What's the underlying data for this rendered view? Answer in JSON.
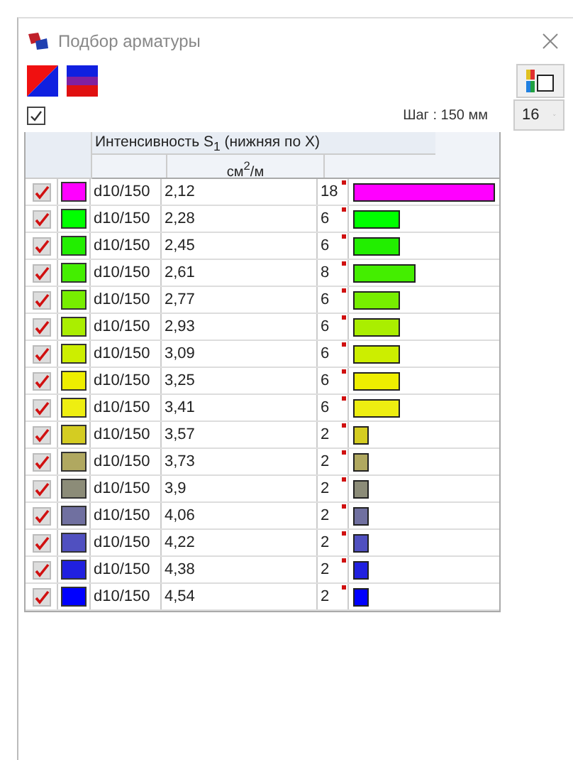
{
  "window": {
    "title": "Подбор арматуры"
  },
  "show_all": {
    "checked": true
  },
  "step": "Шаг : 150 мм",
  "count_select": {
    "value": "16"
  },
  "table": {
    "title": "Интенсивность S$_{1}$ (нижняя по X)",
    "unit": "см$^{2}$/м",
    "rows": [
      {
        "checked": true,
        "color": "#ff00ff",
        "name": "d10/150",
        "value": "2,12",
        "count": "18"
      },
      {
        "checked": true,
        "color": "#00ff00",
        "name": "d10/150",
        "value": "2,28",
        "count": "6"
      },
      {
        "checked": true,
        "color": "#22ee00",
        "name": "d10/150",
        "value": "2,45",
        "count": "6"
      },
      {
        "checked": true,
        "color": "#44ee00",
        "name": "d10/150",
        "value": "2,61",
        "count": "8"
      },
      {
        "checked": true,
        "color": "#77ee00",
        "name": "d10/150",
        "value": "2,77",
        "count": "6"
      },
      {
        "checked": true,
        "color": "#aaee00",
        "name": "d10/150",
        "value": "2,93",
        "count": "6"
      },
      {
        "checked": true,
        "color": "#ccee00",
        "name": "d10/150",
        "value": "3,09",
        "count": "6"
      },
      {
        "checked": true,
        "color": "#eeee00",
        "name": "d10/150",
        "value": "3,25",
        "count": "6"
      },
      {
        "checked": true,
        "color": "#eeee11",
        "name": "d10/150",
        "value": "3,41",
        "count": "6"
      },
      {
        "checked": true,
        "color": "#d4cc22",
        "name": "d10/150",
        "value": "3,57",
        "count": "2"
      },
      {
        "checked": true,
        "color": "#b0a860",
        "name": "d10/150",
        "value": "3,73",
        "count": "2"
      },
      {
        "checked": true,
        "color": "#8c8c78",
        "name": "d10/150",
        "value": "3,9",
        "count": "2"
      },
      {
        "checked": true,
        "color": "#7070a0",
        "name": "d10/150",
        "value": "4,06",
        "count": "2"
      },
      {
        "checked": true,
        "color": "#5050c0",
        "name": "d10/150",
        "value": "4,22",
        "count": "2"
      },
      {
        "checked": true,
        "color": "#2020e0",
        "name": "d10/150",
        "value": "4,38",
        "count": "2"
      },
      {
        "checked": true,
        "color": "#0000ff",
        "name": "d10/150",
        "value": "4,54",
        "count": "2"
      }
    ]
  }
}
